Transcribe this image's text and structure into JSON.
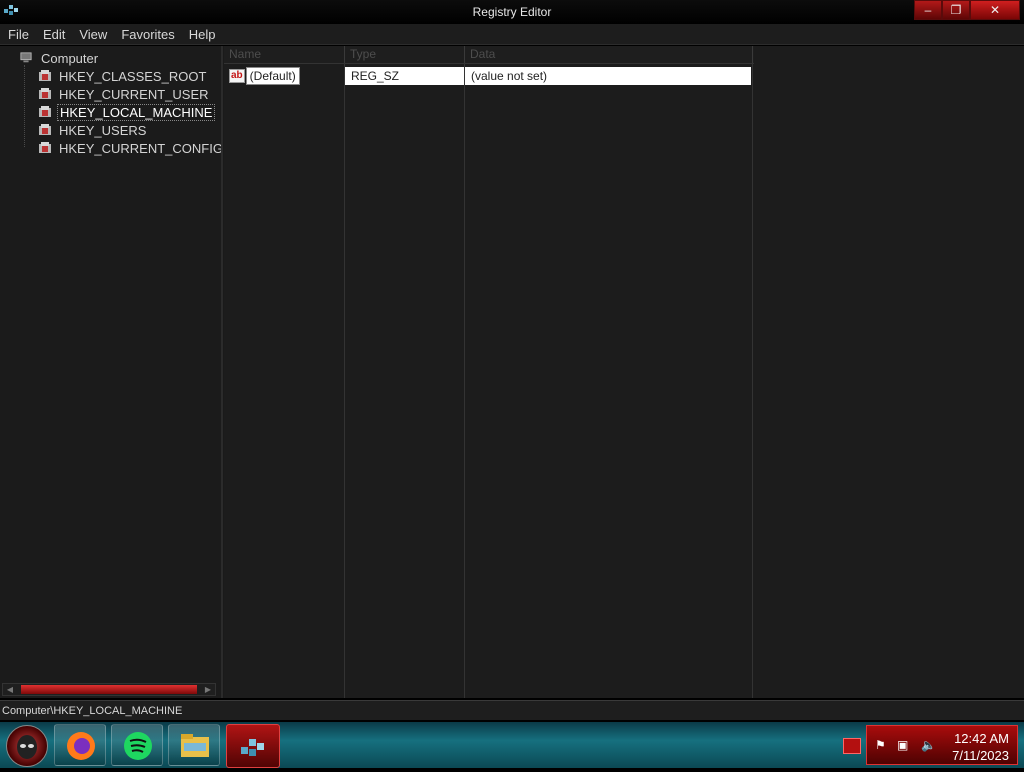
{
  "window": {
    "title": "Registry Editor"
  },
  "menu": [
    "File",
    "Edit",
    "View",
    "Favorites",
    "Help"
  ],
  "tree": {
    "root": "Computer",
    "items": [
      {
        "label": "HKEY_CLASSES_ROOT",
        "selected": false
      },
      {
        "label": "HKEY_CURRENT_USER",
        "selected": false
      },
      {
        "label": "HKEY_LOCAL_MACHINE",
        "selected": true
      },
      {
        "label": "HKEY_USERS",
        "selected": false
      },
      {
        "label": "HKEY_CURRENT_CONFIG",
        "selected": false
      }
    ]
  },
  "list": {
    "columns": [
      "Name",
      "Type",
      "Data"
    ],
    "rows": [
      {
        "name": "(Default)",
        "type": "REG_SZ",
        "data": "(value not set)"
      }
    ]
  },
  "status": {
    "path": "Computer\\HKEY_LOCAL_MACHINE"
  },
  "taskbar": {
    "time": "12:42 AM",
    "date": "7/11/2023",
    "apps": [
      "start-icon",
      "firefox-icon",
      "spotify-icon",
      "file-explorer-icon",
      "registry-editor-icon"
    ]
  },
  "colors": {
    "accent": "#b31919",
    "taskbar": "#16707f",
    "background": "#1a1a1a"
  }
}
